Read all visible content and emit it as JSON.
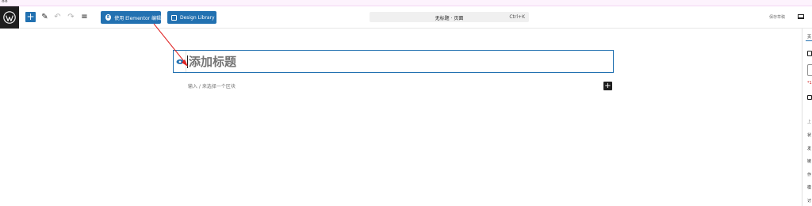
{
  "top_strip": {
    "text": "88"
  },
  "toolbar": {
    "add_block_label": "+",
    "tool_icons": [
      "pencil-icon",
      "undo-icon",
      "redo-icon",
      "document-overview-icon"
    ],
    "elementor_button_label": "使用 Elementor 编辑",
    "design_library_label": "Design Library",
    "command_bar_title": "无标题 · 页面",
    "command_bar_shortcut": "Ctrl+K",
    "save_draft_label": "保存草稿"
  },
  "editor": {
    "title_placeholder": "添加标题",
    "paragraph_placeholder": "输入 / 来选择一个区块",
    "inline_add_label": "+"
  },
  "sidebar": {
    "tab_label": "页",
    "required_marker": "*1",
    "items": [
      "上",
      "状",
      "发",
      "链",
      "作",
      "模",
      "讨"
    ]
  },
  "colors": {
    "accent": "#2271b1",
    "annotation_arrow": "#e02424",
    "wp_bar": "#1e1e1e"
  }
}
